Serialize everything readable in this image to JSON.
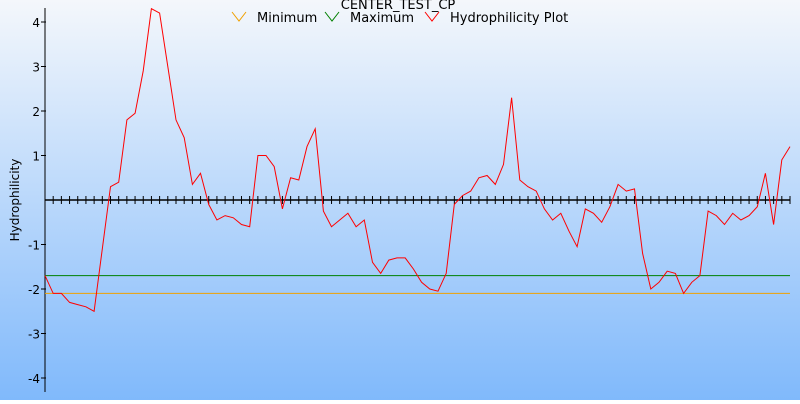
{
  "chart_data": {
    "type": "line",
    "title": "CENTER_TEST_CP",
    "ylabel": "Hydrophilicity",
    "xlabel": "",
    "ylim": [
      -4.3,
      4.3
    ],
    "yticks": [
      4,
      3,
      2,
      1,
      -1,
      -2,
      -3,
      -4
    ],
    "grid": false,
    "legend_position": "top",
    "background_gradient": [
      "#f4f7fb",
      "#80b9fb"
    ],
    "series": [
      {
        "name": "Minimum",
        "color": "#f0a000",
        "kind": "constant",
        "values": [
          -2.1,
          -2.1
        ]
      },
      {
        "name": "Maximum",
        "color": "#008000",
        "kind": "constant",
        "values": [
          -1.7,
          -1.7
        ]
      },
      {
        "name": "Hydrophilicity Plot",
        "color": "#ff0000",
        "kind": "profile",
        "values": [
          -1.7,
          -2.1,
          -2.1,
          -2.3,
          -2.35,
          -2.4,
          -2.5,
          -1.1,
          0.3,
          0.4,
          1.8,
          1.95,
          2.9,
          4.3,
          4.2,
          3.0,
          1.8,
          1.4,
          0.35,
          0.6,
          -0.1,
          -0.45,
          -0.35,
          -0.4,
          -0.55,
          -0.6,
          1.0,
          1.0,
          0.75,
          -0.2,
          0.5,
          0.45,
          1.2,
          1.6,
          -0.25,
          -0.6,
          -0.45,
          -0.3,
          -0.6,
          -0.45,
          -1.4,
          -1.65,
          -1.35,
          -1.3,
          -1.3,
          -1.55,
          -1.85,
          -2.0,
          -2.05,
          -1.65,
          -0.1,
          0.1,
          0.2,
          0.5,
          0.55,
          0.35,
          0.8,
          2.3,
          0.45,
          0.3,
          0.2,
          -0.2,
          -0.45,
          -0.3,
          -0.7,
          -1.05,
          -0.2,
          -0.3,
          -0.5,
          -0.15,
          0.35,
          0.2,
          0.25,
          -1.2,
          -2.0,
          -1.85,
          -1.6,
          -1.65,
          -2.1,
          -1.85,
          -1.7,
          -0.25,
          -0.35,
          -0.55,
          -0.3,
          -0.45,
          -0.35,
          -0.15,
          0.6,
          -0.55,
          0.9,
          1.2
        ]
      }
    ]
  }
}
